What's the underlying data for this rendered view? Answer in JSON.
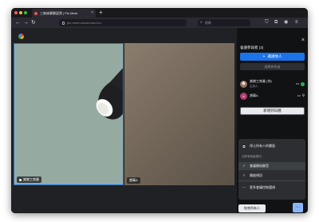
{
  "browser": {
    "tab_title": "三姊妹聊聊居然 | Pie Meet",
    "tab_close": "×",
    "new_tab": "+",
    "url": "pie-meet.mock/room/••••",
    "search_placeholder": "搜尋",
    "nav": {
      "back": "←",
      "forward": "→",
      "reload": "↻"
    }
  },
  "meeting": {
    "tiles": [
      {
        "name": "謝謝工商業",
        "speaking": true
      },
      {
        "name": "趙萬A",
        "speaking": false
      }
    ]
  },
  "panel": {
    "title": "會議參與者 (3)",
    "close": "×",
    "add_people": "邀請他人",
    "add_icon": "+",
    "search_people": "搜尋參與者",
    "participants": [
      {
        "name": "謝謝工商業 (你)",
        "role": "主持人",
        "initial": ""
      },
      {
        "name": "趙萬A",
        "role": "",
        "initial": "A"
      }
    ],
    "add_to_calendar": "新增到日曆",
    "menu": {
      "stop_sharing": "停止所有人的畫面",
      "heading": "允許參與者操作：",
      "option_1": "會議開始靜音",
      "option_2": "開啟視訊",
      "option_3": "更多會議控制選項",
      "check": "✓",
      "stop_icon": "⧉",
      "more_icon": "⋯"
    },
    "end_meeting": "結束所有人",
    "more": "⋯"
  },
  "colors": {
    "accent": "#1a73e8",
    "active_speaker_border": "#1a73e8",
    "more_button": "#8ab4f8",
    "status_green": "#34a853"
  }
}
